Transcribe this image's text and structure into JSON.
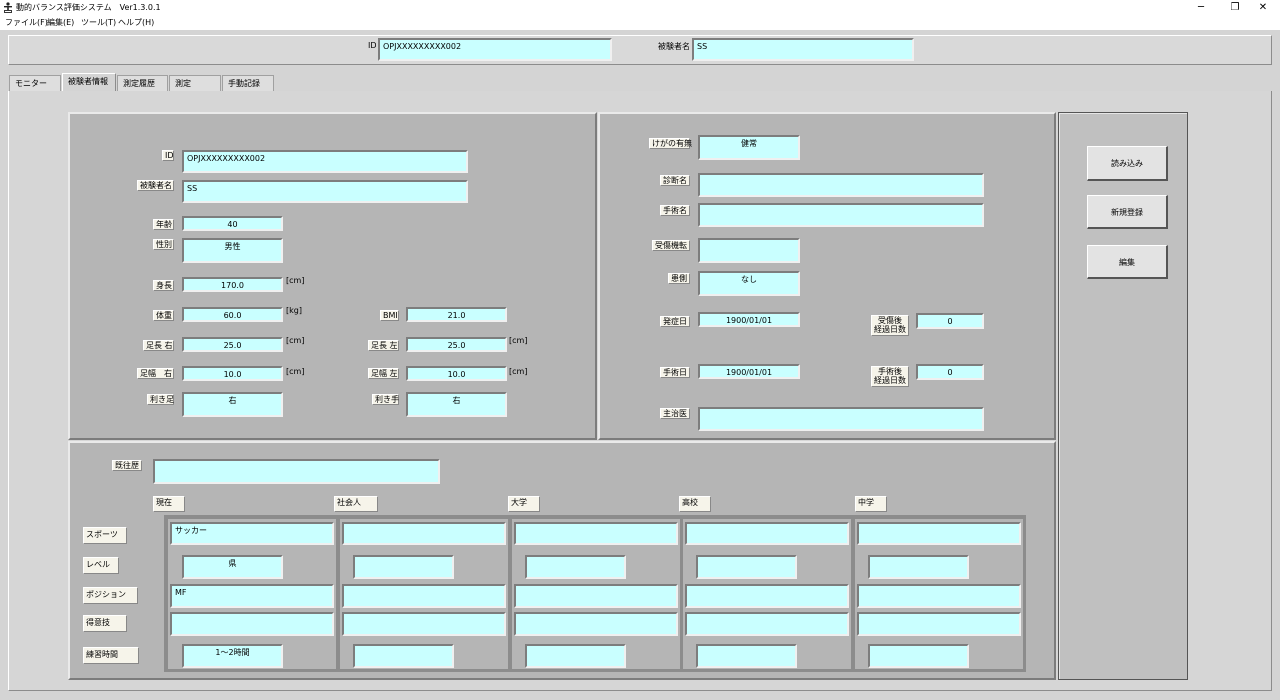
{
  "window": {
    "title": "動的バランス評価システム　Ver1.3.0.1",
    "controls": {
      "minimize": "─",
      "restore": "❐",
      "close": "✕"
    }
  },
  "menu": [
    "ファイル(F)",
    "編集(E)",
    "ツール(T)",
    "ヘルプ(H)"
  ],
  "header": {
    "id_label": "ID",
    "id_value": "OPJXXXXXXXXX002",
    "name_label": "被験者名",
    "name_value": "SS"
  },
  "tabs": [
    "モニター",
    "被験者情報",
    "測定履歴",
    "測定",
    "手動記録"
  ],
  "active_tab": 1,
  "subject": {
    "id_label": "ID",
    "id_value": "OPJXXXXXXXXX002",
    "name_label": "被験者名",
    "name_value": "SS",
    "age_label": "年齢",
    "age_value": "40",
    "sex_label": "性別",
    "sex_value": "男性",
    "height_label": "身長",
    "height_value": "170.0",
    "height_unit": "[cm]",
    "weight_label": "体重",
    "weight_value": "60.0",
    "weight_unit": "[kg]",
    "bmi_label": "BMI",
    "bmi_value": "21.0",
    "foot_len_r_label": "足長 右",
    "foot_len_r_value": "25.0",
    "foot_len_r_unit": "[cm]",
    "foot_len_l_label": "足長 左",
    "foot_len_l_value": "25.0",
    "foot_len_l_unit": "[cm]",
    "foot_w_r_label": "足幅　右",
    "foot_w_r_value": "10.0",
    "foot_w_r_unit": "[cm]",
    "foot_w_l_label": "足幅 左",
    "foot_w_l_value": "10.0",
    "foot_w_l_unit": "[cm]",
    "dom_foot_label": "利き足",
    "dom_foot_value": "右",
    "dom_hand_label": "利き手",
    "dom_hand_value": "右"
  },
  "injury": {
    "has_injury_label": "けがの有無",
    "has_injury_value": "健常",
    "diagnosis_label": "診断名",
    "diagnosis_value": "",
    "surgery_name_label": "手術名",
    "surgery_name_value": "",
    "mechanism_label": "受傷機転",
    "mechanism_value": "",
    "side_label": "患側",
    "side_value": "なし",
    "onset_label": "発症日",
    "onset_value": "1900/01/01",
    "days_since_injury_label": "受傷後\n経過日数",
    "days_since_injury_value": "0",
    "surgery_date_label": "手術日",
    "surgery_date_value": "1900/01/01",
    "days_since_surgery_label": "手術後\n経過日数",
    "days_since_surgery_value": "0",
    "doctor_label": "主治医",
    "doctor_value": ""
  },
  "actions": {
    "load": "読み込み",
    "new": "新規登録",
    "edit": "編集"
  },
  "history": {
    "past_label": "既往歴",
    "past_value": "",
    "columns": [
      "現在",
      "社会人",
      "大学",
      "高校",
      "中学"
    ],
    "rows": [
      {
        "label": "スポーツ",
        "values": [
          "サッカー",
          "",
          "",
          "",
          ""
        ]
      },
      {
        "label": "レベル",
        "values": [
          "県",
          "",
          "",
          "",
          ""
        ]
      },
      {
        "label": "ポジション",
        "values": [
          "MF",
          "",
          "",
          "",
          ""
        ]
      },
      {
        "label": "得意技",
        "values": [
          "",
          "",
          "",
          "",
          ""
        ]
      },
      {
        "label": "練習時間",
        "values": [
          "1～2時間",
          "",
          "",
          "",
          ""
        ]
      }
    ]
  }
}
